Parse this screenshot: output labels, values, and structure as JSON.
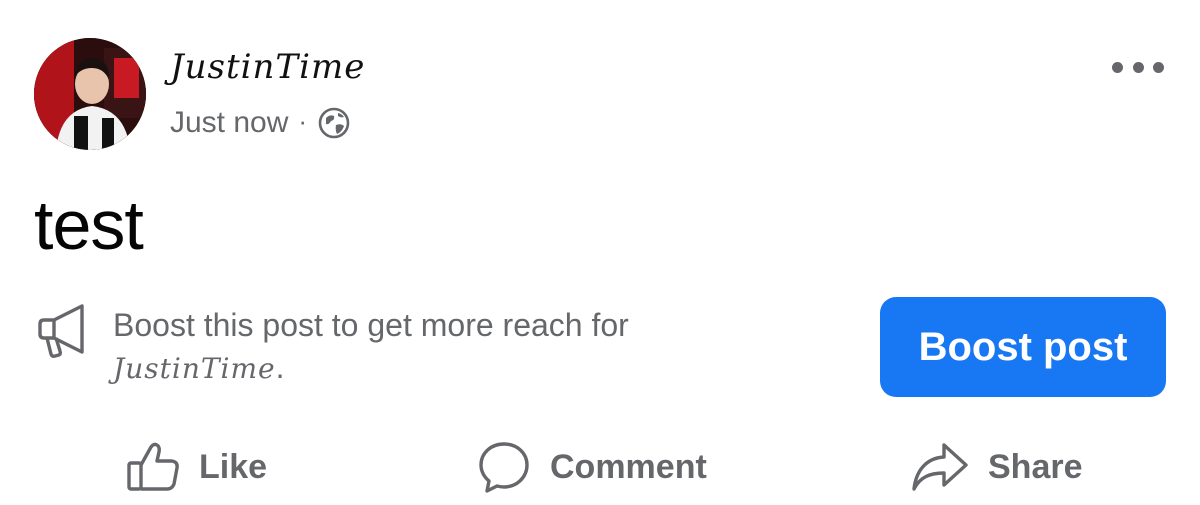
{
  "post": {
    "author": "JustinTime",
    "timestamp": "Just now",
    "separator": "·",
    "audience_icon": "globe-icon",
    "more_icon": "more-options-icon",
    "text": "test"
  },
  "boost": {
    "icon": "megaphone-icon",
    "message_prefix": "Boost this post to get more reach for ",
    "message_name": "JustinTime",
    "message_suffix": ".",
    "button_label": "Boost post"
  },
  "actions": [
    {
      "label": "Like",
      "icon": "thumbs-up-icon"
    },
    {
      "label": "Comment",
      "icon": "comment-bubble-icon"
    },
    {
      "label": "Share",
      "icon": "share-arrow-icon"
    }
  ],
  "colors": {
    "primary_button": "#1877f2",
    "secondary_text": "#65676b",
    "primary_text": "#050505"
  }
}
